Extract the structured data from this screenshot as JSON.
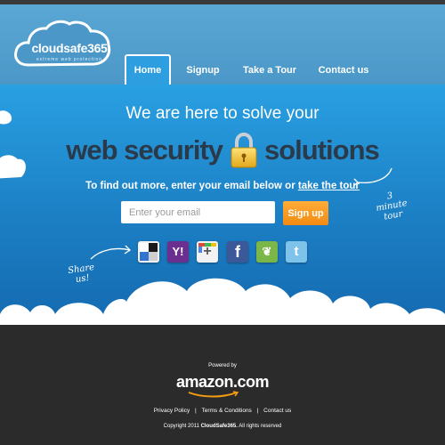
{
  "brand": {
    "name": "cloudsafe365",
    "tagline": "extreme web protection"
  },
  "nav": {
    "items": [
      {
        "label": "Home"
      },
      {
        "label": "Signup"
      },
      {
        "label": "Take a Tour"
      },
      {
        "label": "Contact us"
      }
    ],
    "active": "Home"
  },
  "hero": {
    "line1": "We are here to solve your",
    "line2_left": "web security",
    "line2_right": "solutions",
    "cta_text": "To find out more, enter your email below or",
    "cta_link": "take the tour",
    "email_placeholder": "Enter your email",
    "signup_label": "Sign up",
    "note_tour": "3 minute tour",
    "note_share": "Share us!"
  },
  "social": [
    {
      "name": "delicious",
      "glyph": ""
    },
    {
      "name": "yahoo",
      "glyph": "Y!"
    },
    {
      "name": "google-plus",
      "glyph": "+"
    },
    {
      "name": "facebook",
      "glyph": "f"
    },
    {
      "name": "evernote",
      "glyph": "❦"
    },
    {
      "name": "twitter",
      "glyph": "t"
    }
  ],
  "footer": {
    "powered_by": "Powered by",
    "amazon": "amazon.com",
    "links": [
      "Privacy Policy",
      "Terms & Conditions",
      "Contact us"
    ],
    "separator": "|",
    "copyright_prefix": "Copyright 2011",
    "copyright_brand": "CloudSafe365.",
    "copyright_suffix": "All rights reserved"
  },
  "colors": {
    "header": "#5aa6d4",
    "hero": "#29a0e2",
    "footer": "#2b2b2b",
    "signup": "#f28a10",
    "headline": "#2a3a4a"
  }
}
